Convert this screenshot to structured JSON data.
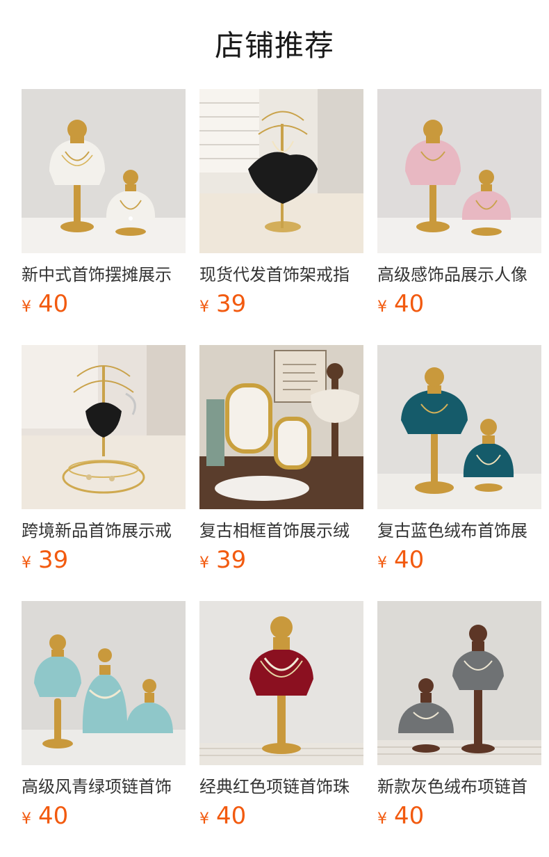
{
  "section": {
    "title": "店铺推荐"
  },
  "products": [
    {
      "title": "新中式首饰摆摊展示",
      "currency": "¥",
      "price": "40",
      "image": "white-jacquard-necklace-busts",
      "colors": {
        "bg": "#dedcd9",
        "table": "#f3f1ee",
        "bust": "#f3f1ec",
        "base": "#c9993c",
        "neck": "#c9993c"
      }
    },
    {
      "title": "现货代发首饰架戒指",
      "currency": "¥",
      "price": "39",
      "image": "black-dress-earring-stand",
      "colors": {
        "bg": "#ece8e1",
        "table": "#efe7da",
        "bust": "#1b1b1b",
        "base": "#d3ae5a",
        "neck": "#c9a24a"
      }
    },
    {
      "title": "高级感饰品展示人像",
      "currency": "¥",
      "price": "40",
      "image": "pink-velvet-necklace-busts",
      "colors": {
        "bg": "#dfdcdb",
        "table": "#f2f0ee",
        "bust": "#e8b8c2",
        "base": "#c9993c",
        "neck": "#c9993c"
      }
    },
    {
      "title": "跨境新品首饰展示戒",
      "currency": "¥",
      "price": "39",
      "image": "black-dress-tray-stand",
      "colors": {
        "bg": "#e8e2dc",
        "table": "#efe8de",
        "bust": "#1a1a1a",
        "base": "#cfa94f",
        "neck": "#c9a24a"
      }
    },
    {
      "title": "复古相框首饰展示绒",
      "currency": "¥",
      "price": "39",
      "image": "vintage-frames-jewelry-display",
      "colors": {
        "bg": "#d9d2c7",
        "table": "#5a3d2c",
        "bust": "#efe9df",
        "base": "#c9a03e",
        "neck": "#5b3b27"
      }
    },
    {
      "title": "复古蓝色绒布首饰展",
      "currency": "¥",
      "price": "40",
      "image": "teal-velvet-necklace-busts",
      "colors": {
        "bg": "#e1dfdc",
        "table": "#efede9",
        "bust": "#155b6a",
        "base": "#c9993c",
        "neck": "#c9993c"
      }
    },
    {
      "title": "高级风青绿项链首饰",
      "currency": "¥",
      "price": "40",
      "image": "mint-green-necklace-busts",
      "colors": {
        "bg": "#dcdad7",
        "table": "#ecebe8",
        "bust": "#8fc7c9",
        "base": "#c9993c",
        "neck": "#c9993c"
      }
    },
    {
      "title": "经典红色项链首饰珠",
      "currency": "¥",
      "price": "40",
      "image": "burgundy-velvet-necklace-bust",
      "colors": {
        "bg": "#e6e4e1",
        "table": "#eae6df",
        "bust": "#8b1020",
        "base": "#c9993c",
        "neck": "#c9993c"
      }
    },
    {
      "title": "新款灰色绒布项链首",
      "currency": "¥",
      "price": "40",
      "image": "grey-velvet-necklace-busts",
      "colors": {
        "bg": "#dcdad6",
        "table": "#e8e4de",
        "bust": "#6f7274",
        "base": "#5d3626",
        "neck": "#5d3626"
      }
    }
  ]
}
